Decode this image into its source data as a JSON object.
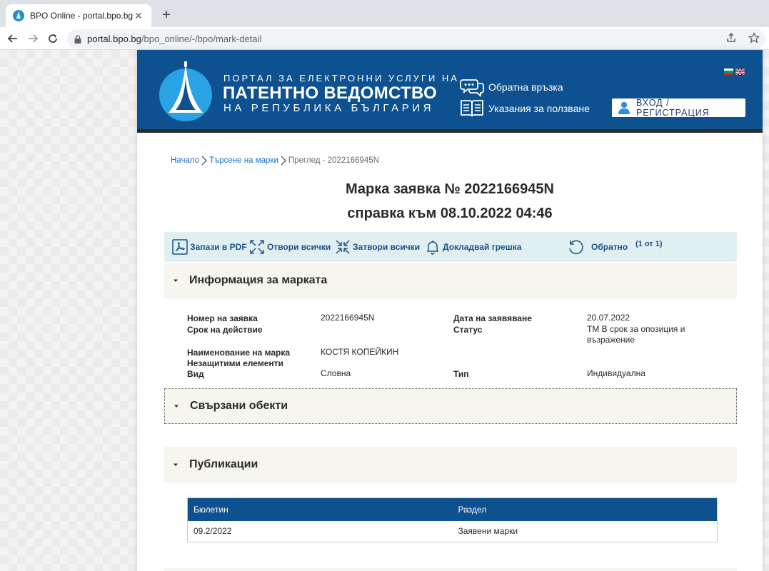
{
  "browser": {
    "tab_title": "BPO Online - portal.bpo.bg",
    "url_host": "portal.bpo.bg",
    "url_path": "/bpo_online/-/bpo/mark-detail"
  },
  "header": {
    "logo_line1": "ПОРТАЛ ЗА ЕЛЕКТРОННИ УСЛУГИ НА",
    "logo_line2": "ПАТЕНТНО ВЕДОМСТВО",
    "logo_line3": "НА РЕПУБЛИКА БЪЛГАРИЯ",
    "feedback_label": "Обратна връзка",
    "guide_label": "Указания за ползване",
    "login_label": "ВХОД / РЕГИСТРАЦИЯ",
    "brand_color": "#0e5190"
  },
  "breadcrumb": {
    "home": "Начало",
    "search": "Търсене на марки",
    "current": "Преглед - 2022166945N"
  },
  "title": {
    "line1": "Марка заявка № 2022166945N",
    "line2": "справка към 08.10.2022 04:46"
  },
  "actions": {
    "save_pdf": "Запази в PDF",
    "open_all": "Отвори всички",
    "close_all": "Затвори всички",
    "report_error": "Докладвай грешка",
    "back": "Обратно",
    "pager": "(1 от 1)"
  },
  "sections": {
    "info": "Информация за марката",
    "related": "Свързани обекти",
    "publications": "Публикации"
  },
  "info": {
    "app_no_label": "Номер на заявка",
    "app_no_value": "2022166945N",
    "filing_date_label": "Дата на заявяване",
    "filing_date_value": "20.07.2022",
    "validity_label": "Срок на действие",
    "status_label": "Статус",
    "status_value_line1": "TM В срок за опозиция и",
    "status_value_line2": "възражение",
    "name_label": "Наименование на марка",
    "name_value": "КОСТЯ КОПЕЙКИН",
    "unprotected_label": "Незащитими елементи",
    "kind_label": "Вид",
    "kind_value": "Словна",
    "type_label": "Тип",
    "type_value": "Индивидуална"
  },
  "publications": {
    "headers": [
      "Бюлетин",
      "Раздел"
    ],
    "rows": [
      [
        "09.2/2022",
        "Заявени марки"
      ]
    ]
  }
}
